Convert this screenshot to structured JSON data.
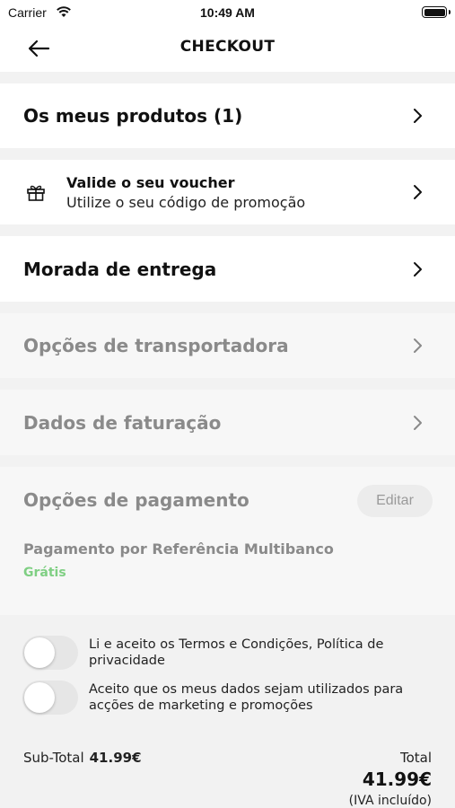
{
  "status_bar": {
    "carrier": "Carrier",
    "time": "10:49 AM"
  },
  "nav": {
    "title": "CHECKOUT"
  },
  "products": {
    "title": "Os meus produtos (1)"
  },
  "voucher": {
    "title": "Valide o seu voucher",
    "subtitle": "Utilize o seu código de promoção"
  },
  "delivery": {
    "title": "Morada de entrega"
  },
  "carrier_options": {
    "title": "Opções de transportadora"
  },
  "billing": {
    "title": "Dados de faturação"
  },
  "payment": {
    "title": "Opções de pagamento",
    "edit_label": "Editar",
    "method": "Pagamento por Referência Multibanco",
    "price": "Grátis"
  },
  "consents": {
    "terms_label": "Li e aceito os Termos e Condições, Política de privacidade",
    "terms_checked": false,
    "marketing_label": "Aceito que os meus dados sejam utilizados para acções de marketing e promoções",
    "marketing_checked": false
  },
  "totals": {
    "subtotal_label": "Sub-Total",
    "subtotal_value": "41.99€",
    "total_label": "Total",
    "total_value": "41.99€",
    "vat_note": "(IVA incluído)"
  },
  "colors": {
    "accent_free": "#7fcf83",
    "disabled_text": "#8a8a8a",
    "background": "#f2f2f2"
  },
  "icons": [
    "wifi-icon",
    "battery-icon",
    "back-arrow-icon",
    "chevron-right-icon",
    "gift-icon"
  ]
}
